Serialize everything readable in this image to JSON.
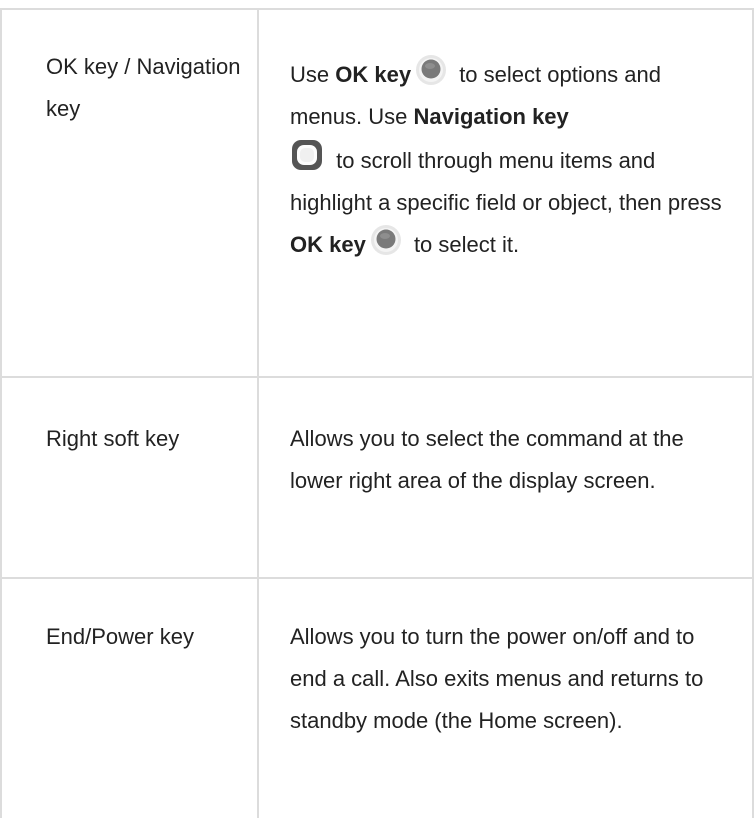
{
  "rows": [
    {
      "key": "OK key / Navigation key",
      "desc": {
        "t1": "Use ",
        "b1": "OK key",
        "t2": " to select options and menus. Use ",
        "b2": "Navigation key",
        "t3": " to scroll through menu items and highlight a specific field or object, then press ",
        "b3": "OK key",
        "t4": " to select it."
      }
    },
    {
      "key": "Right soft key",
      "desc": "Allows you to select the command at the lower right area of the display screen."
    },
    {
      "key": "End/Power key",
      "desc": "Allows you to turn the power on/off and to end a call. Also exits menus and returns to standby mode (the Home screen)."
    }
  ],
  "icons": [
    "ok-key-icon",
    "navigation-key-icon"
  ]
}
